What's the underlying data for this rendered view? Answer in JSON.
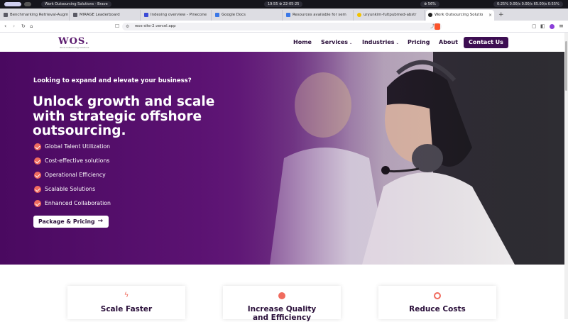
{
  "system_bar": {
    "window_title": "Work Outsourcing Solutions - Brave",
    "clock": "19:55 ⊕ 22-05-25",
    "status_left": "⊕ 56%",
    "status_right": "0:25% 0.00/s 0.00/s 65.00/s 0:55%"
  },
  "tabs": [
    {
      "label": "Benchmarking Retrieval-Augm",
      "color": "#5b5b66"
    },
    {
      "label": "MIRAGE Leaderboard",
      "color": "#5b5b66"
    },
    {
      "label": "Indexing overview - Pinecone",
      "color": "#3b4bd6"
    },
    {
      "label": "Google Docs",
      "color": "#3b78e7"
    },
    {
      "label": "Resources available for sem",
      "color": "#3b78e7"
    },
    {
      "label": "uryunkim-fultpubmed-abstr",
      "color": "#f2c200"
    },
    {
      "label": "Work Outsourcing Solutio",
      "color": "#222222"
    }
  ],
  "address_bar": {
    "url": "wos-site-2.vercel.app"
  },
  "site": {
    "logo": "WOS.",
    "logo_tagline": "Work Outsourcing Solutions",
    "nav": {
      "home": "Home",
      "services": "Services",
      "industries": "Industries",
      "pricing": "Pricing",
      "about": "About",
      "contact": "Contact Us"
    },
    "hero": {
      "eyebrow": "Looking to expand and elevate your business?",
      "headline": "Unlock growth and scale with strategic offshore outsourcing.",
      "features": [
        "Global Talent Utilization",
        "Cost-effective solutions",
        "Operational Efficiency",
        "Scalable Solutions",
        "Enhanced Collaboration"
      ],
      "cta": "Package & Pricing"
    },
    "cards": [
      {
        "title": "Scale Faster"
      },
      {
        "title": "Increase Quality and Efficiency"
      },
      {
        "title": "Reduce Costs"
      }
    ]
  },
  "colors": {
    "brand": "#3d0e52",
    "accent": "#f06b5e"
  }
}
